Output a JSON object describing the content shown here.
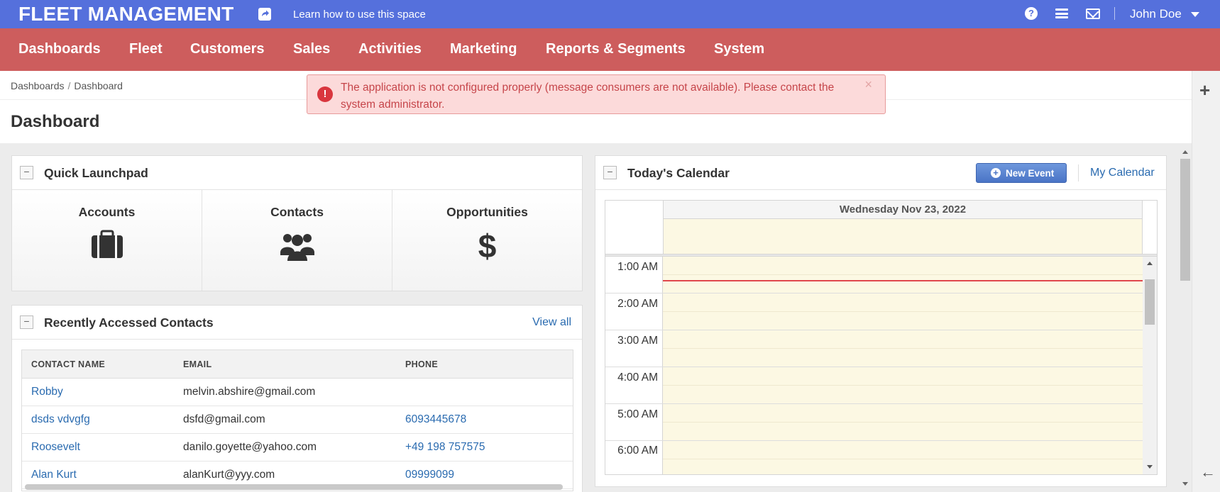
{
  "topbar": {
    "app_title": "FLEET MANAGEMENT",
    "learn_link": "Learn how to use this space",
    "help_icon_glyph": "?",
    "user_name": "John Doe",
    "icons": [
      "share-icon",
      "help-icon",
      "menu-icon",
      "mail-icon",
      "caret-down-icon"
    ]
  },
  "nav": {
    "items": [
      {
        "label": "Dashboards"
      },
      {
        "label": "Fleet"
      },
      {
        "label": "Customers"
      },
      {
        "label": "Sales"
      },
      {
        "label": "Activities"
      },
      {
        "label": "Marketing"
      },
      {
        "label": "Reports & Segments"
      },
      {
        "label": "System"
      }
    ]
  },
  "breadcrumb": {
    "items": [
      "Dashboards",
      "Dashboard"
    ],
    "separator": "/"
  },
  "page_title": "Dashboard",
  "alert": {
    "icon": "!",
    "message": "The application is not configured properly (message consumers are not available). Please contact the system administrator.",
    "close": "×"
  },
  "quick_launchpad": {
    "title": "Quick Launchpad",
    "collapse": "−",
    "tiles": [
      {
        "label": "Accounts",
        "icon": "briefcase-icon"
      },
      {
        "label": "Contacts",
        "icon": "users-icon"
      },
      {
        "label": "Opportunities",
        "icon": "dollar-icon",
        "glyph": "$"
      }
    ]
  },
  "recent_contacts": {
    "title": "Recently Accessed Contacts",
    "collapse": "−",
    "view_all": "View all",
    "columns": [
      "CONTACT NAME",
      "EMAIL",
      "PHONE"
    ],
    "rows": [
      {
        "name": "Robby",
        "email": "melvin.abshire@gmail.com",
        "phone": ""
      },
      {
        "name": "dsds vdvgfg",
        "email": "dsfd@gmail.com",
        "phone": "6093445678"
      },
      {
        "name": "Roosevelt",
        "email": "danilo.goyette@yahoo.com",
        "phone": "+49 198 757575"
      },
      {
        "name": "Alan Kurt",
        "email": "alanKurt@yyy.com",
        "phone": "09999099"
      }
    ]
  },
  "calendar": {
    "title": "Today's Calendar",
    "collapse": "−",
    "new_event": "New Event",
    "new_event_plus": "+",
    "my_calendar": "My Calendar",
    "day_header": "Wednesday Nov 23, 2022",
    "times": [
      "1:00 AM",
      "2:00 AM",
      "3:00 AM",
      "4:00 AM",
      "5:00 AM",
      "6:00 AM"
    ]
  },
  "right_rail": {
    "plus": "+",
    "arrow": "←"
  },
  "colors": {
    "topbar": "#5570dc",
    "nav": "#cd5d5d",
    "alert_bg": "#fcdada",
    "alert_text": "#c6454a",
    "link": "#2a6bb0",
    "calendar_slot": "#fcf8e3",
    "now_line": "#e0474c"
  }
}
